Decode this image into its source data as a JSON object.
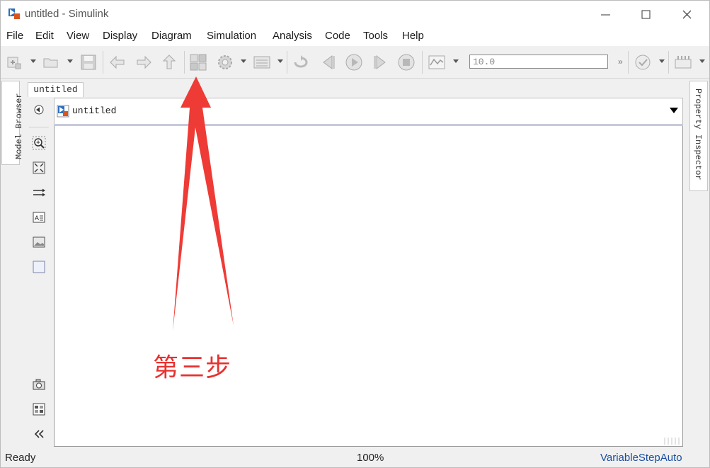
{
  "window": {
    "title": "untitled - Simulink"
  },
  "menu": [
    "File",
    "Edit",
    "View",
    "Display",
    "Diagram",
    "Simulation",
    "Analysis",
    "Code",
    "Tools",
    "Help"
  ],
  "toolbar": {
    "stop_time": "10.0",
    "more": "»",
    "icons": [
      "new-model-icon",
      "open-icon",
      "save-icon",
      "back-icon",
      "forward-icon",
      "up-icon",
      "library-browser-icon",
      "model-settings-icon",
      "model-explorer-icon",
      "step-back-loop-icon",
      "step-back-icon",
      "run-icon",
      "step-forward-icon",
      "stop-icon",
      "scope-icon",
      "check-icon",
      "build-icon"
    ]
  },
  "side_panels": {
    "left": "Model Browser",
    "right": "Property Inspector"
  },
  "document_tab": "untitled",
  "explorer_bar": {
    "path": "untitled"
  },
  "annotation": {
    "text": "第三步",
    "color": "#e8312f"
  },
  "status": {
    "left": "Ready",
    "zoom": "100%",
    "solver": "VariableStepAuto"
  },
  "colors": {
    "accent": "#1a4fa0",
    "annotation": "#e8312f"
  }
}
